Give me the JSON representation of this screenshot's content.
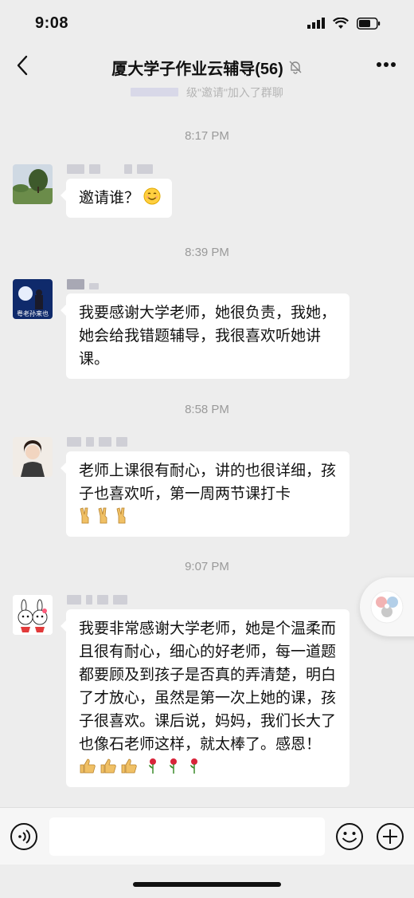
{
  "status_bar": {
    "time": "9:08"
  },
  "header": {
    "title": "厦大学子作业云辅导(56)",
    "back_icon": "chevron-left-icon",
    "mute_icon": "bell-slash-icon",
    "more_icon": "more-dots-icon"
  },
  "system_notice": "级\"邀请\"加入了群聊",
  "messages": [
    {
      "timestamp": "8:17 PM",
      "avatar": "landscape-avatar",
      "text": "邀请谁？"
    },
    {
      "timestamp": "8:39 PM",
      "avatar": "night-avatar",
      "avatar_caption": "粤老孙来也",
      "text": "我要感谢大学老师，她很负责，我她，她会给我错题辅导，我很喜欢听她讲课。"
    },
    {
      "timestamp": "8:58 PM",
      "avatar": "girl-avatar",
      "text": "老师上课很有耐心，讲的也很详细，孩子也喜欢听，第一周两节课打卡"
    },
    {
      "timestamp": "9:07 PM",
      "avatar": "bunny-avatar",
      "text": "我要非常感谢大学老师，她是个温柔而且很有耐心，细心的好老师，每一道题都要顾及到孩子是否真的弄清楚，明白了才放心，虽然是第一次上她的课，孩子很喜欢。课后说，妈妈，我们长大了也像石老师这样，就太棒了。感恩！"
    }
  ],
  "input_bar": {
    "placeholder": "",
    "voice_icon": "voice-icon",
    "emoji_icon": "smiley-icon",
    "plus_icon": "plus-circle-icon"
  },
  "colors": {
    "background": "#ededed",
    "bubble": "#ffffff",
    "timestamp": "#9a9a9a"
  }
}
